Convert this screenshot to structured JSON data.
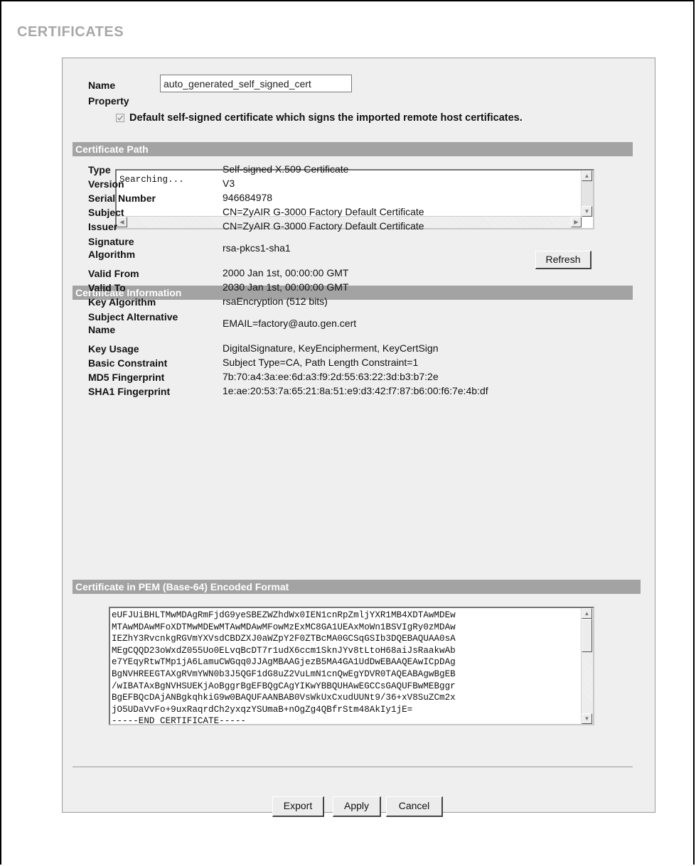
{
  "page": {
    "title": "CERTIFICATES"
  },
  "form": {
    "name_label": "Name",
    "name_value": "auto_generated_self_signed_cert",
    "property_label": "Property",
    "default_checkbox_label": "Default self-signed certificate which signs the imported remote host certificates.",
    "default_checked": true
  },
  "cert_path": {
    "section_title": "Certificate Path",
    "content": "Searching...",
    "refresh_label": "Refresh"
  },
  "cert_info": {
    "section_title": "Certificate Information",
    "rows": [
      {
        "label": "Type",
        "value": "Self-signed X.509 Certificate"
      },
      {
        "label": "Version",
        "value": "V3"
      },
      {
        "label": "Serial Number",
        "value": "946684978"
      },
      {
        "label": "Subject",
        "value": "CN=ZyAIR G-3000 Factory Default Certificate"
      },
      {
        "label": "Issuer",
        "value": "CN=ZyAIR G-3000 Factory Default Certificate"
      },
      {
        "label": "Signature Algorithm",
        "label_line1": "Signature",
        "label_line2": "Algorithm",
        "value": "rsa-pkcs1-sha1"
      },
      {
        "label": "Valid From",
        "value": "2000 Jan 1st, 00:00:00 GMT"
      },
      {
        "label": "Valid To",
        "value": "2030 Jan 1st, 00:00:00 GMT"
      },
      {
        "label": "Key Algorithm",
        "value": "rsaEncryption (512 bits)"
      },
      {
        "label": "Subject Alternative Name",
        "label_line1": "Subject Alternative",
        "label_line2": "Name",
        "value": "EMAIL=factory@auto.gen.cert"
      },
      {
        "label": "Key Usage",
        "value": "DigitalSignature, KeyEncipherment, KeyCertSign"
      },
      {
        "label": "Basic Constraint",
        "value": "Subject Type=CA, Path Length Constraint=1"
      },
      {
        "label": "MD5 Fingerprint",
        "value": "7b:70:a4:3a:ee:6d:a3:f9:2d:55:63:22:3d:b3:b7:2e"
      },
      {
        "label": "SHA1 Fingerprint",
        "value": "1e:ae:20:53:7a:65:21:8a:51:e9:d3:42:f7:87:b6:00:f6:7e:4b:df"
      }
    ]
  },
  "pem": {
    "section_title": "Certificate in PEM (Base-64) Encoded Format",
    "lines": [
      "eUFJUiBHLTMwMDAgRmFjdG9yeSBEZWZhdWx0IEN1cnRpZmljYXR1MB4XDTAwMDEw",
      "MTAwMDAwMFoXDTMwMDEwMTAwMDAwMFowMzExMC8GA1UEAxMoWn1BSVIgRy0zMDAw",
      "IEZhY3RvcnkgRGVmYXVsdCBDZXJ0aWZpY2F0ZTBcMA0GCSqGSIb3DQEBAQUAA0sA",
      "MEgCQQD23oWxdZ055Uo0ELvqBcDT7r1udX6ccm1SknJYv8tLtoH68aiJsRaakwAb",
      "e7YEqyRtwTMp1jA6LamuCWGqq0JJAgMBAAGjezB5MA4GA1UdDwEBAAQEAwICpDAg",
      "BgNVHREEGTAXgRVmYWN0b3J5QGF1dG8uZ2VuLmN1cnQwEgYDVR0TAQEABAgwBgEB",
      "/wIBATAxBgNVHSUEKjAoBggrBgEFBQgCAgYIKwYBBQUHAwEGCCsGAQUFBwMEBggr",
      "BgEFBQcDAjANBgkqhkiG9w0BAQUFAANBAB0VsWkUxCxudUUNt9/36+xV8SuZCm2x",
      "jO5UDaVvFo+9uxRaqrdCh2yxqzYSUmaB+nOgZg4QBfrStm48AkIy1jE=",
      "-----END CERTIFICATE-----"
    ]
  },
  "actions": {
    "export_label": "Export",
    "apply_label": "Apply",
    "cancel_label": "Cancel"
  }
}
